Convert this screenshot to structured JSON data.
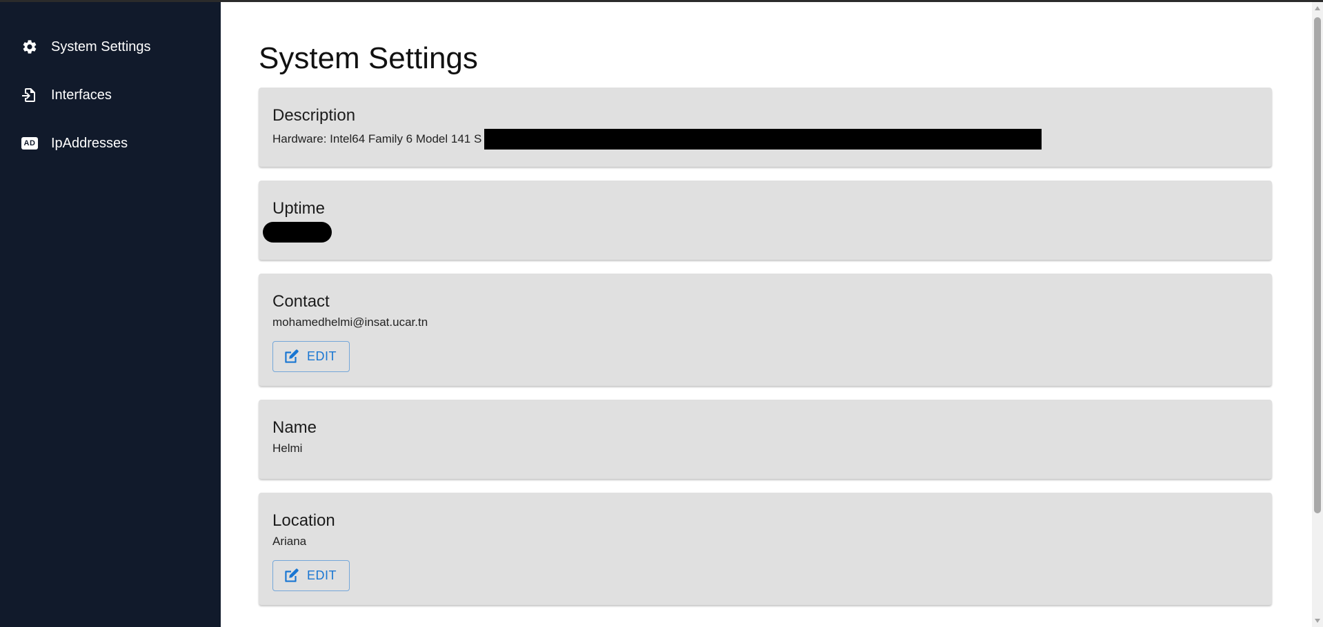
{
  "sidebar": {
    "items": [
      {
        "label": "System Settings",
        "icon": "gear-icon"
      },
      {
        "label": "Interfaces",
        "icon": "file-import-icon"
      },
      {
        "label": "IpAddresses",
        "icon": "ad-icon",
        "badge": "AD"
      }
    ]
  },
  "main": {
    "title": "System Settings",
    "cards": {
      "description": {
        "title": "Description",
        "value": "Hardware: Intel64 Family 6 Model 141 S"
      },
      "uptime": {
        "title": "Uptime",
        "value": ""
      },
      "contact": {
        "title": "Contact",
        "value": "mohamedhelmi@insat.ucar.tn",
        "edit_label": "EDIT"
      },
      "name": {
        "title": "Name",
        "value": "Helmi"
      },
      "location": {
        "title": "Location",
        "value": "Ariana",
        "edit_label": "EDIT"
      }
    }
  },
  "colors": {
    "sidebar_bg": "#111a2b",
    "card_bg": "#e0e0e0",
    "accent": "#1976d2"
  }
}
